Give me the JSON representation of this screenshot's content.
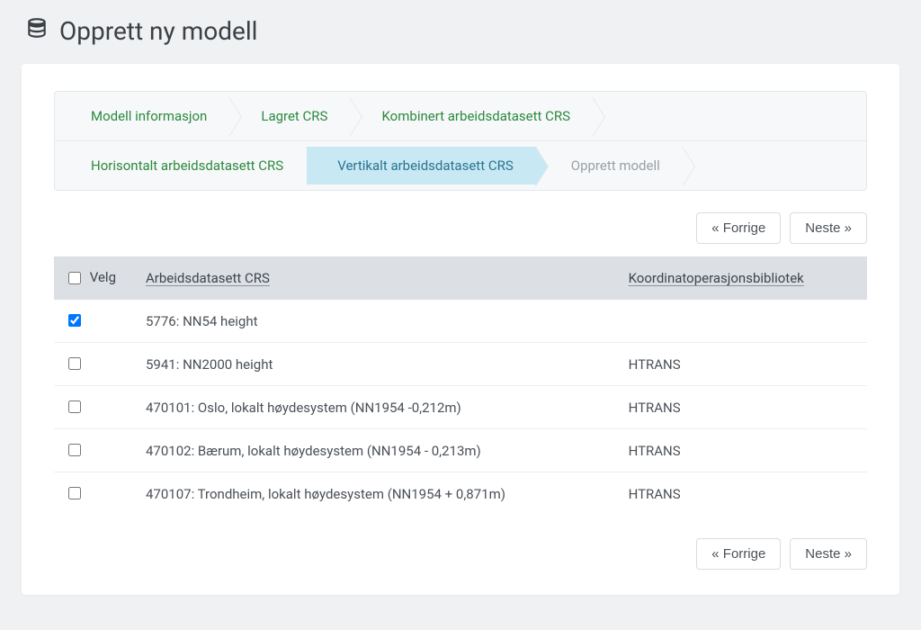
{
  "title": "Opprett ny modell",
  "wizard": {
    "row1": [
      {
        "label": "Modell informasjon",
        "state": "done"
      },
      {
        "label": "Lagret CRS",
        "state": "done"
      },
      {
        "label": "Kombinert arbeidsdatasett CRS",
        "state": "done"
      }
    ],
    "row2": [
      {
        "label": "Horisontalt arbeidsdatasett CRS",
        "state": "done"
      },
      {
        "label": "Vertikalt arbeidsdatasett CRS",
        "state": "active"
      },
      {
        "label": "Opprett modell",
        "state": "disabled"
      }
    ]
  },
  "buttons": {
    "prev": "« Forrige",
    "next": "Neste »"
  },
  "table": {
    "headers": {
      "select": "Velg",
      "crs": "Arbeidsdatasett CRS",
      "lib": "Koordinatoperasjonsbibliotek"
    },
    "rows": [
      {
        "checked": true,
        "crs": "5776: NN54 height",
        "lib": ""
      },
      {
        "checked": false,
        "crs": "5941: NN2000 height",
        "lib": "HTRANS"
      },
      {
        "checked": false,
        "crs": "470101: Oslo, lokalt høydesystem (NN1954 -0,212m)",
        "lib": "HTRANS"
      },
      {
        "checked": false,
        "crs": "470102: Bærum, lokalt høydesystem (NN1954 - 0,213m)",
        "lib": "HTRANS"
      },
      {
        "checked": false,
        "crs": "470107: Trondheim, lokalt høydesystem (NN1954 + 0,871m)",
        "lib": "HTRANS"
      }
    ]
  }
}
